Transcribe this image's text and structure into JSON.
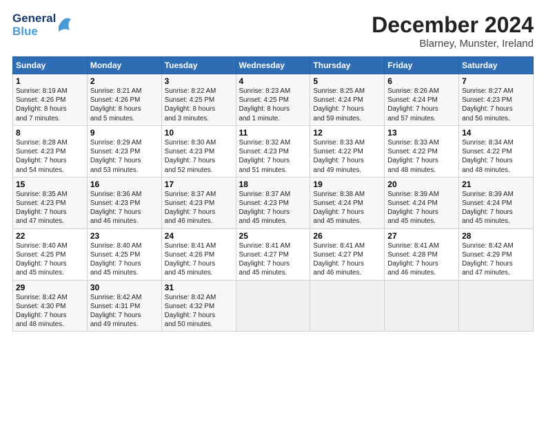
{
  "header": {
    "logo_line1": "General",
    "logo_line2": "Blue",
    "month": "December 2024",
    "location": "Blarney, Munster, Ireland"
  },
  "weekdays": [
    "Sunday",
    "Monday",
    "Tuesday",
    "Wednesday",
    "Thursday",
    "Friday",
    "Saturday"
  ],
  "weeks": [
    [
      {
        "day": "1",
        "info": "Sunrise: 8:19 AM\nSunset: 4:26 PM\nDaylight: 8 hours\nand 7 minutes."
      },
      {
        "day": "2",
        "info": "Sunrise: 8:21 AM\nSunset: 4:26 PM\nDaylight: 8 hours\nand 5 minutes."
      },
      {
        "day": "3",
        "info": "Sunrise: 8:22 AM\nSunset: 4:25 PM\nDaylight: 8 hours\nand 3 minutes."
      },
      {
        "day": "4",
        "info": "Sunrise: 8:23 AM\nSunset: 4:25 PM\nDaylight: 8 hours\nand 1 minute."
      },
      {
        "day": "5",
        "info": "Sunrise: 8:25 AM\nSunset: 4:24 PM\nDaylight: 7 hours\nand 59 minutes."
      },
      {
        "day": "6",
        "info": "Sunrise: 8:26 AM\nSunset: 4:24 PM\nDaylight: 7 hours\nand 57 minutes."
      },
      {
        "day": "7",
        "info": "Sunrise: 8:27 AM\nSunset: 4:23 PM\nDaylight: 7 hours\nand 56 minutes."
      }
    ],
    [
      {
        "day": "8",
        "info": "Sunrise: 8:28 AM\nSunset: 4:23 PM\nDaylight: 7 hours\nand 54 minutes."
      },
      {
        "day": "9",
        "info": "Sunrise: 8:29 AM\nSunset: 4:23 PM\nDaylight: 7 hours\nand 53 minutes."
      },
      {
        "day": "10",
        "info": "Sunrise: 8:30 AM\nSunset: 4:23 PM\nDaylight: 7 hours\nand 52 minutes."
      },
      {
        "day": "11",
        "info": "Sunrise: 8:32 AM\nSunset: 4:23 PM\nDaylight: 7 hours\nand 51 minutes."
      },
      {
        "day": "12",
        "info": "Sunrise: 8:33 AM\nSunset: 4:22 PM\nDaylight: 7 hours\nand 49 minutes."
      },
      {
        "day": "13",
        "info": "Sunrise: 8:33 AM\nSunset: 4:22 PM\nDaylight: 7 hours\nand 48 minutes."
      },
      {
        "day": "14",
        "info": "Sunrise: 8:34 AM\nSunset: 4:22 PM\nDaylight: 7 hours\nand 48 minutes."
      }
    ],
    [
      {
        "day": "15",
        "info": "Sunrise: 8:35 AM\nSunset: 4:23 PM\nDaylight: 7 hours\nand 47 minutes."
      },
      {
        "day": "16",
        "info": "Sunrise: 8:36 AM\nSunset: 4:23 PM\nDaylight: 7 hours\nand 46 minutes."
      },
      {
        "day": "17",
        "info": "Sunrise: 8:37 AM\nSunset: 4:23 PM\nDaylight: 7 hours\nand 46 minutes."
      },
      {
        "day": "18",
        "info": "Sunrise: 8:37 AM\nSunset: 4:23 PM\nDaylight: 7 hours\nand 45 minutes."
      },
      {
        "day": "19",
        "info": "Sunrise: 8:38 AM\nSunset: 4:24 PM\nDaylight: 7 hours\nand 45 minutes."
      },
      {
        "day": "20",
        "info": "Sunrise: 8:39 AM\nSunset: 4:24 PM\nDaylight: 7 hours\nand 45 minutes."
      },
      {
        "day": "21",
        "info": "Sunrise: 8:39 AM\nSunset: 4:24 PM\nDaylight: 7 hours\nand 45 minutes."
      }
    ],
    [
      {
        "day": "22",
        "info": "Sunrise: 8:40 AM\nSunset: 4:25 PM\nDaylight: 7 hours\nand 45 minutes."
      },
      {
        "day": "23",
        "info": "Sunrise: 8:40 AM\nSunset: 4:25 PM\nDaylight: 7 hours\nand 45 minutes."
      },
      {
        "day": "24",
        "info": "Sunrise: 8:41 AM\nSunset: 4:26 PM\nDaylight: 7 hours\nand 45 minutes."
      },
      {
        "day": "25",
        "info": "Sunrise: 8:41 AM\nSunset: 4:27 PM\nDaylight: 7 hours\nand 45 minutes."
      },
      {
        "day": "26",
        "info": "Sunrise: 8:41 AM\nSunset: 4:27 PM\nDaylight: 7 hours\nand 46 minutes."
      },
      {
        "day": "27",
        "info": "Sunrise: 8:41 AM\nSunset: 4:28 PM\nDaylight: 7 hours\nand 46 minutes."
      },
      {
        "day": "28",
        "info": "Sunrise: 8:42 AM\nSunset: 4:29 PM\nDaylight: 7 hours\nand 47 minutes."
      }
    ],
    [
      {
        "day": "29",
        "info": "Sunrise: 8:42 AM\nSunset: 4:30 PM\nDaylight: 7 hours\nand 48 minutes."
      },
      {
        "day": "30",
        "info": "Sunrise: 8:42 AM\nSunset: 4:31 PM\nDaylight: 7 hours\nand 49 minutes."
      },
      {
        "day": "31",
        "info": "Sunrise: 8:42 AM\nSunset: 4:32 PM\nDaylight: 7 hours\nand 50 minutes."
      },
      null,
      null,
      null,
      null
    ]
  ]
}
